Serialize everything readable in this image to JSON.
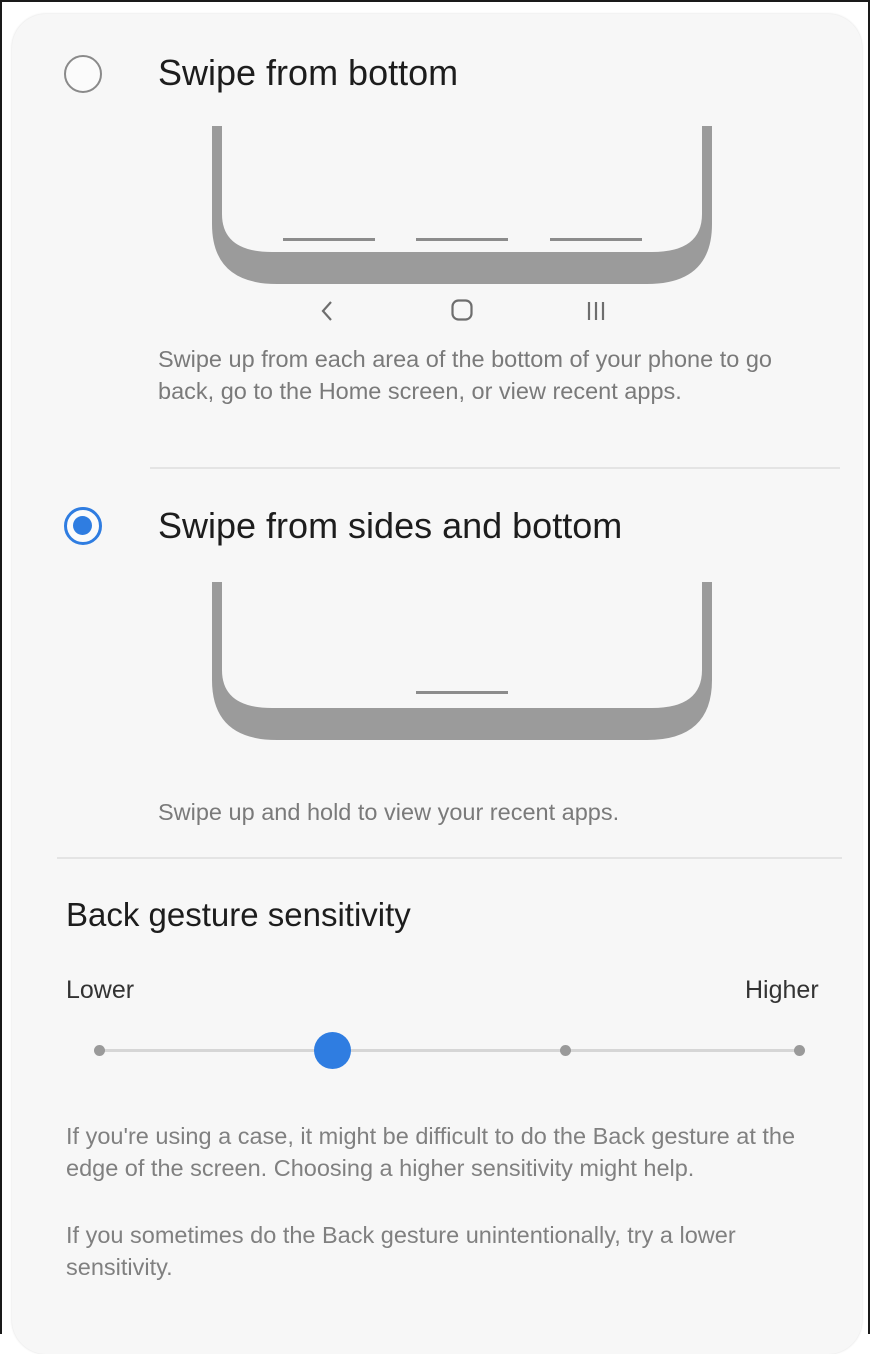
{
  "navigation_options": [
    {
      "title": "Swipe from bottom",
      "selected": false,
      "description": "Swipe up from each area of the bottom of your phone to go back, go to the Home screen, or view recent apps.",
      "nav_icons": [
        "back-icon",
        "home-icon",
        "recents-icon"
      ]
    },
    {
      "title": "Swipe from sides and bottom",
      "selected": true,
      "description": "Swipe up and hold to view your recent apps."
    }
  ],
  "sensitivity": {
    "title": "Back gesture sensitivity",
    "low_label": "Lower",
    "high_label": "Higher",
    "levels": 4,
    "selected_level": 2,
    "note1": "If you're using a case, it might be difficult to do the Back gesture at the edge of the screen. Choosing a higher sensitivity might help.",
    "note2": "If you sometimes do the Back gesture unintentionally, try a lower sensitivity."
  },
  "colors": {
    "accent": "#2f7de1",
    "card": "#f7f7f7",
    "phone_outline": "#9b9b9b"
  }
}
